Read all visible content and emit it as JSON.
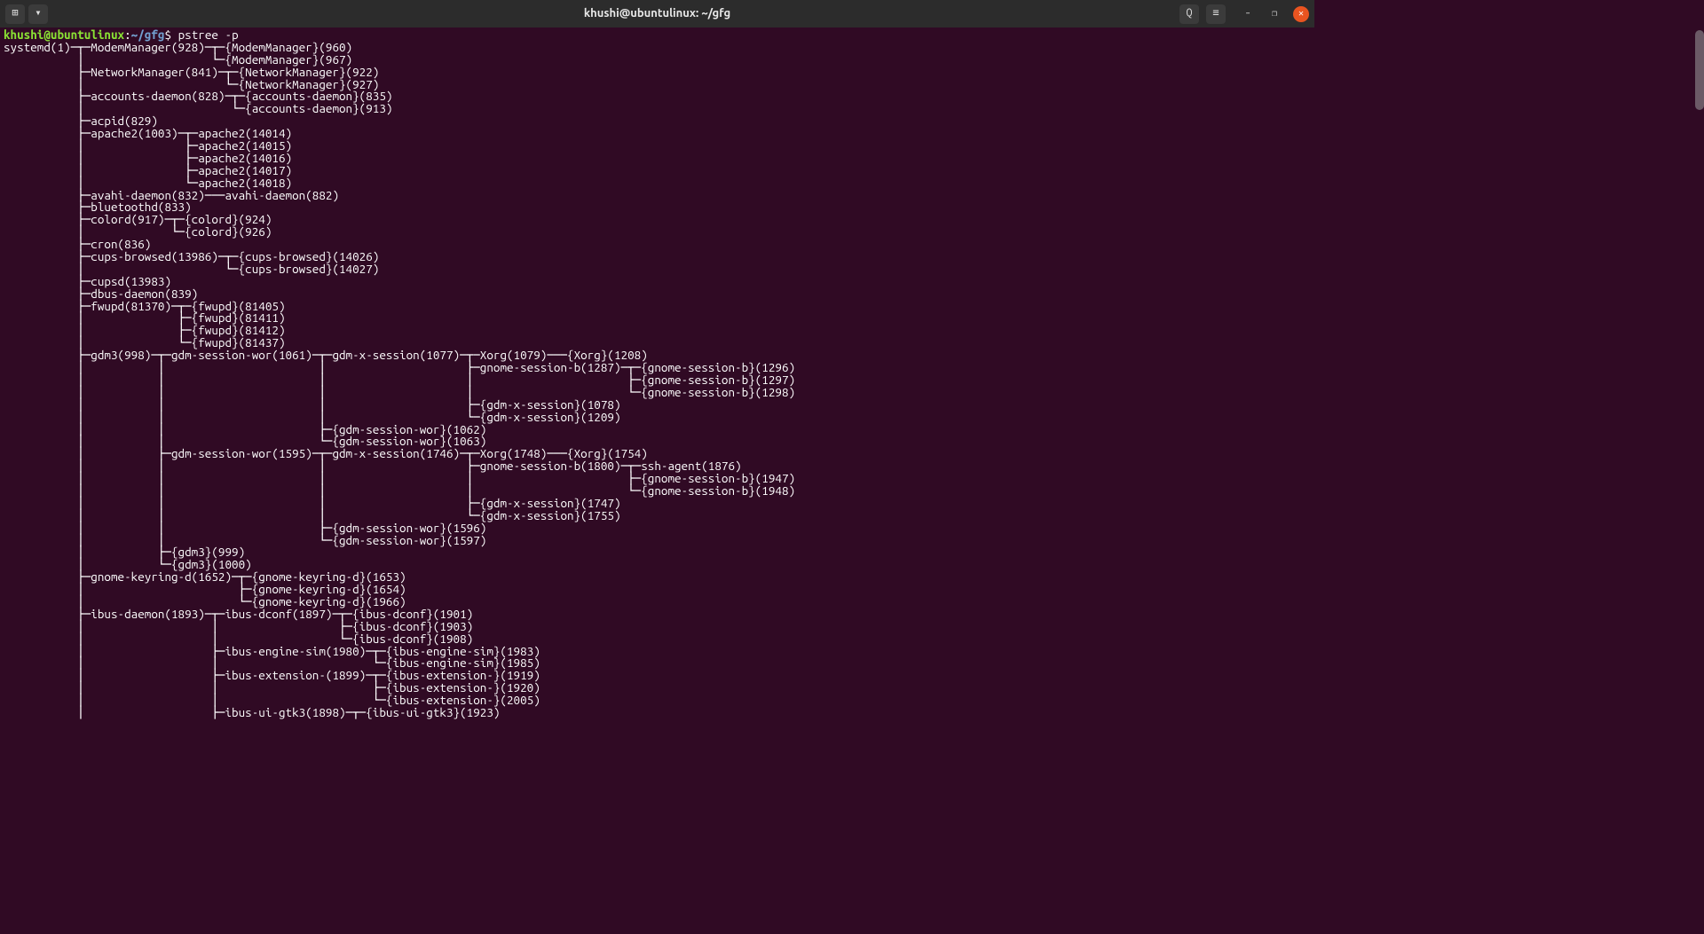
{
  "titlebar": {
    "title": "khushi@ubuntulinux: ~/gfg",
    "newTabIcon": "⊞",
    "dropdownIcon": "▾",
    "searchIcon": "Q",
    "menuIcon": "≡",
    "minIcon": "–",
    "maxIcon": "❐",
    "closeIcon": "✕"
  },
  "prompt": {
    "user": "khushi@ubuntulinux",
    "colon": ":",
    "path": "~/gfg",
    "dollar": "$",
    "command": "pstree -p"
  },
  "output": "systemd(1)─┬─ModemManager(928)─┬─{ModemManager}(960)\n           │                   └─{ModemManager}(967)\n           ├─NetworkManager(841)─┬─{NetworkManager}(922)\n           │                     └─{NetworkManager}(927)\n           ├─accounts-daemon(828)─┬─{accounts-daemon}(835)\n           │                      └─{accounts-daemon}(913)\n           ├─acpid(829)\n           ├─apache2(1003)─┬─apache2(14014)\n           │               ├─apache2(14015)\n           │               ├─apache2(14016)\n           │               ├─apache2(14017)\n           │               └─apache2(14018)\n           ├─avahi-daemon(832)───avahi-daemon(882)\n           ├─bluetoothd(833)\n           ├─colord(917)─┬─{colord}(924)\n           │             └─{colord}(926)\n           ├─cron(836)\n           ├─cups-browsed(13986)─┬─{cups-browsed}(14026)\n           │                     └─{cups-browsed}(14027)\n           ├─cupsd(13983)\n           ├─dbus-daemon(839)\n           ├─fwupd(81370)─┬─{fwupd}(81405)\n           │              ├─{fwupd}(81411)\n           │              ├─{fwupd}(81412)\n           │              └─{fwupd}(81437)\n           ├─gdm3(998)─┬─gdm-session-wor(1061)─┬─gdm-x-session(1077)─┬─Xorg(1079)───{Xorg}(1208)\n           │           │                       │                     ├─gnome-session-b(1287)─┬─{gnome-session-b}(1296)\n           │           │                       │                     │                       ├─{gnome-session-b}(1297)\n           │           │                       │                     │                       └─{gnome-session-b}(1298)\n           │           │                       │                     ├─{gdm-x-session}(1078)\n           │           │                       │                     └─{gdm-x-session}(1209)\n           │           │                       ├─{gdm-session-wor}(1062)\n           │           │                       └─{gdm-session-wor}(1063)\n           │           ├─gdm-session-wor(1595)─┬─gdm-x-session(1746)─┬─Xorg(1748)───{Xorg}(1754)\n           │           │                       │                     ├─gnome-session-b(1800)─┬─ssh-agent(1876)\n           │           │                       │                     │                       ├─{gnome-session-b}(1947)\n           │           │                       │                     │                       └─{gnome-session-b}(1948)\n           │           │                       │                     ├─{gdm-x-session}(1747)\n           │           │                       │                     └─{gdm-x-session}(1755)\n           │           │                       ├─{gdm-session-wor}(1596)\n           │           │                       └─{gdm-session-wor}(1597)\n           │           ├─{gdm3}(999)\n           │           └─{gdm3}(1000)\n           ├─gnome-keyring-d(1652)─┬─{gnome-keyring-d}(1653)\n           │                       ├─{gnome-keyring-d}(1654)\n           │                       └─{gnome-keyring-d}(1966)\n           ├─ibus-daemon(1893)─┬─ibus-dconf(1897)─┬─{ibus-dconf}(1901)\n           │                   │                  ├─{ibus-dconf}(1903)\n           │                   │                  └─{ibus-dconf}(1908)\n           │                   ├─ibus-engine-sim(1980)─┬─{ibus-engine-sim}(1983)\n           │                   │                       └─{ibus-engine-sim}(1985)\n           │                   ├─ibus-extension-(1899)─┬─{ibus-extension-}(1919)\n           │                   │                       ├─{ibus-extension-}(1920)\n           │                   │                       └─{ibus-extension-}(2005)\n           │                   ├─ibus-ui-gtk3(1898)─┬─{ibus-ui-gtk3}(1923)"
}
